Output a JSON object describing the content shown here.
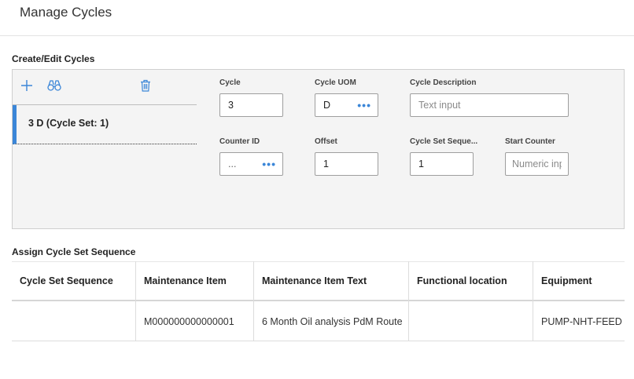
{
  "page": {
    "title": "Manage Cycles"
  },
  "create_edit": {
    "heading": "Create/Edit Cycles",
    "toolbar": {
      "add_icon": "plus-icon",
      "search_icon": "binoculars-icon",
      "delete_icon": "trash-icon"
    },
    "cycles": [
      {
        "label": "3 D (Cycle Set: 1)",
        "selected": true
      }
    ],
    "fields": {
      "cycle": {
        "label": "Cycle",
        "value": "3"
      },
      "cycle_uom": {
        "label": "Cycle UOM",
        "value": "D",
        "ellipsis": "•••"
      },
      "cycle_description": {
        "label": "Cycle Description",
        "value": "",
        "placeholder": "Text input"
      },
      "counter_id": {
        "label": "Counter ID",
        "value": "...",
        "ellipsis": "•••"
      },
      "offset": {
        "label": "Offset",
        "value": "1"
      },
      "cycle_set_sequence": {
        "label": "Cycle Set Seque...",
        "value": "1"
      },
      "start_counter": {
        "label": "Start Counter",
        "value": "",
        "placeholder": "Numeric input"
      }
    }
  },
  "assign": {
    "heading": "Assign Cycle Set Sequence",
    "columns": [
      "Cycle Set Sequence",
      "Maintenance Item",
      "Maintenance Item Text",
      "Functional location",
      "Equipment"
    ],
    "rows": [
      {
        "cycle_set_sequence": "",
        "maintenance_item": "M000000000000001",
        "maintenance_item_text": "6 Month Oil analysis PdM Route",
        "functional_location": "",
        "equipment": "PUMP-NHT-FEED"
      }
    ]
  },
  "colors": {
    "accent": "#3b86d8",
    "panel_bg": "#f4f4f4",
    "border": "#cfcfcf"
  }
}
